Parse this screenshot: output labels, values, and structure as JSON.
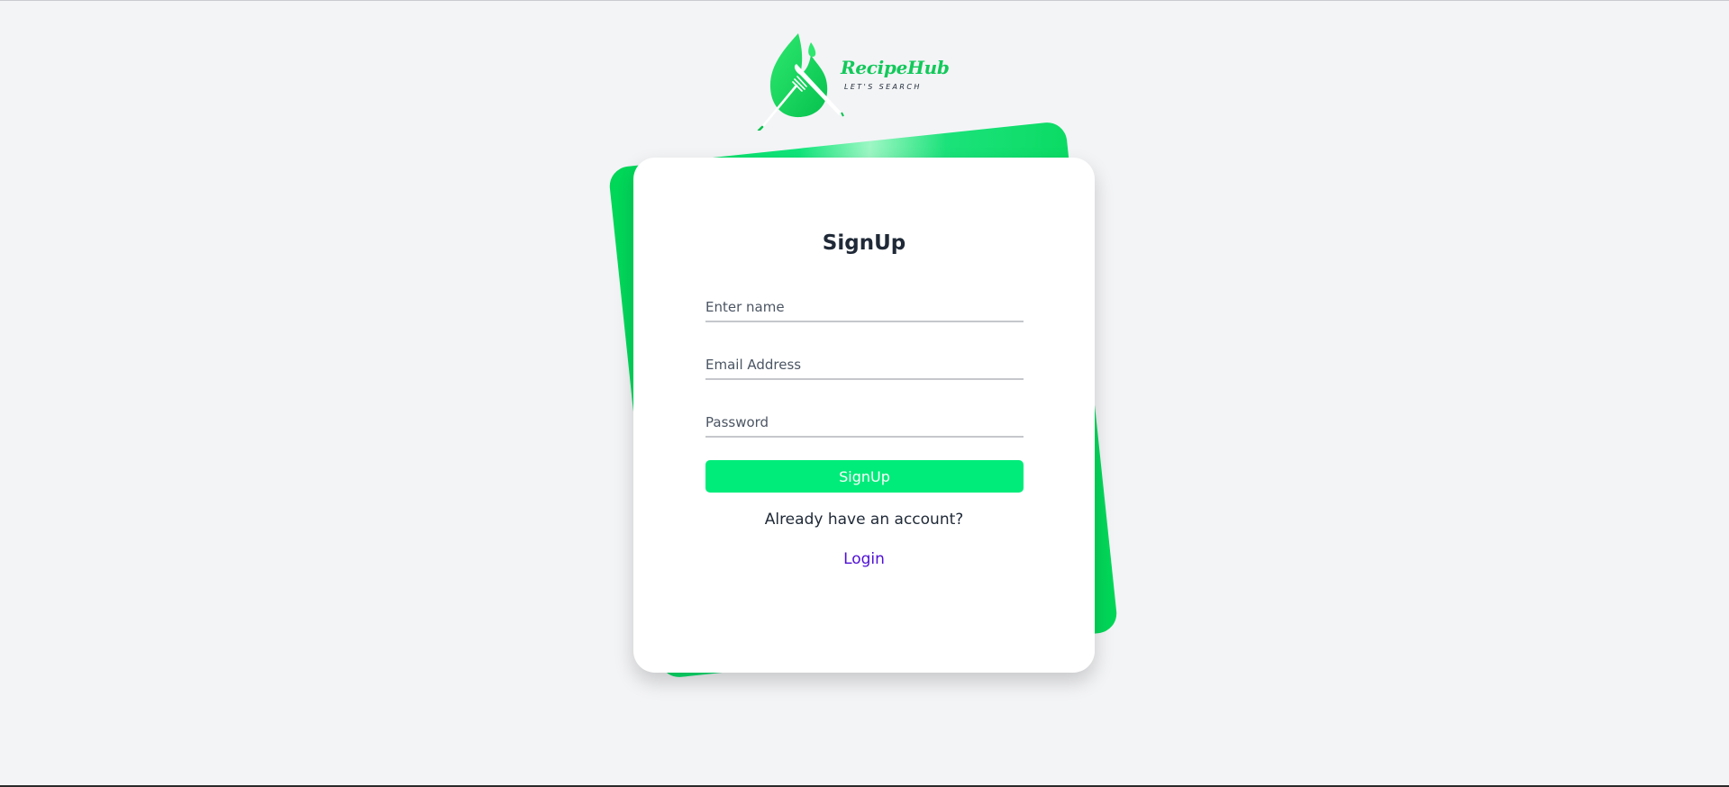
{
  "brand": {
    "name": "RecipeHub",
    "tagline": "LET'S SEARCH"
  },
  "icons": {
    "logo": "flame-fork-knife-icon"
  },
  "colors": {
    "accent": "#00ec7a",
    "logo_green": "#12c95a",
    "link": "#4f0fd6",
    "background": "#f3f4f6"
  },
  "form": {
    "title": "SignUp",
    "name_placeholder": "Enter name",
    "email_placeholder": "Email Address",
    "password_placeholder": "Password",
    "submit_label": "SignUp",
    "have_account_text": "Already have an account?",
    "login_label": "Login"
  }
}
